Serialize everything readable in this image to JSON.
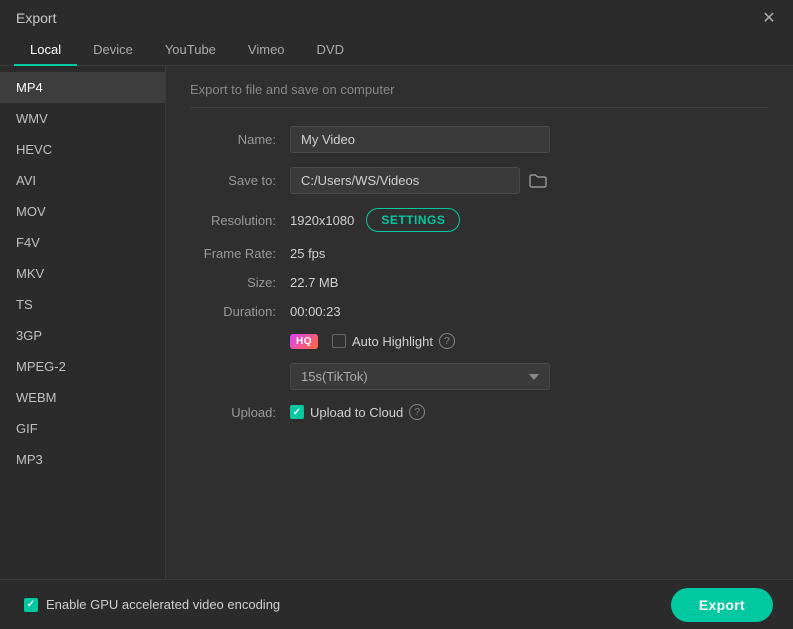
{
  "titleBar": {
    "title": "Export"
  },
  "tabs": [
    {
      "id": "local",
      "label": "Local",
      "active": true
    },
    {
      "id": "device",
      "label": "Device",
      "active": false
    },
    {
      "id": "youtube",
      "label": "YouTube",
      "active": false
    },
    {
      "id": "vimeo",
      "label": "Vimeo",
      "active": false
    },
    {
      "id": "dvd",
      "label": "DVD",
      "active": false
    }
  ],
  "sidebar": {
    "items": [
      {
        "id": "mp4",
        "label": "MP4",
        "active": true
      },
      {
        "id": "wmv",
        "label": "WMV",
        "active": false
      },
      {
        "id": "hevc",
        "label": "HEVC",
        "active": false
      },
      {
        "id": "avi",
        "label": "AVI",
        "active": false
      },
      {
        "id": "mov",
        "label": "MOV",
        "active": false
      },
      {
        "id": "f4v",
        "label": "F4V",
        "active": false
      },
      {
        "id": "mkv",
        "label": "MKV",
        "active": false
      },
      {
        "id": "ts",
        "label": "TS",
        "active": false
      },
      {
        "id": "3gp",
        "label": "3GP",
        "active": false
      },
      {
        "id": "mpeg2",
        "label": "MPEG-2",
        "active": false
      },
      {
        "id": "webm",
        "label": "WEBM",
        "active": false
      },
      {
        "id": "gif",
        "label": "GIF",
        "active": false
      },
      {
        "id": "mp3",
        "label": "MP3",
        "active": false
      }
    ]
  },
  "content": {
    "description": "Export to file and save on computer",
    "nameLabel": "Name:",
    "nameValue": "My Video",
    "saveToLabel": "Save to:",
    "saveToPath": "C:/Users/WS/Videos",
    "resolutionLabel": "Resolution:",
    "resolutionValue": "1920x1080",
    "settingsLabel": "SETTINGS",
    "frameRateLabel": "Frame Rate:",
    "frameRateValue": "25 fps",
    "sizeLabel": "Size:",
    "sizeValue": "22.7 MB",
    "durationLabel": "Duration:",
    "durationValue": "00:00:23",
    "hqBadge": "HQ",
    "autoHighlightLabel": "Auto Highlight",
    "highlightHelpIcon": "?",
    "uploadLabel": "Upload:",
    "uploadToCloudLabel": "Upload to Cloud",
    "uploadHelpIcon": "?",
    "dropdownOptions": [
      {
        "value": "15s_tiktok",
        "label": "15s(TikTok)"
      }
    ],
    "dropdownSelected": "15s(TikTok)",
    "autoHighlightChecked": false,
    "uploadToCloudChecked": true
  },
  "bottomBar": {
    "gpuLabel": "Enable GPU accelerated video encoding",
    "gpuChecked": true,
    "exportLabel": "Export"
  }
}
